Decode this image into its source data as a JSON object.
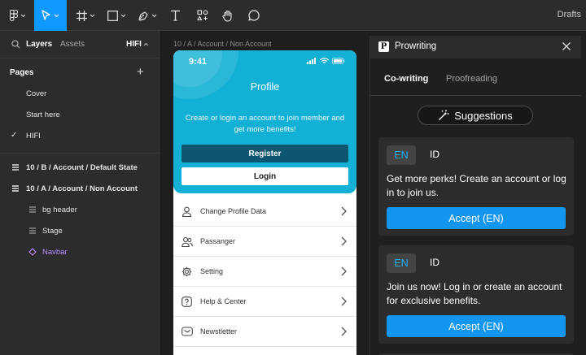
{
  "toolbar": {
    "drafts_label": "Drafts",
    "tools": [
      "figma-menu-icon",
      "move-tool-icon",
      "frame-tool-icon",
      "shape-tool-icon",
      "pen-tool-icon",
      "text-tool-icon",
      "resources-icon",
      "hand-tool-icon",
      "comment-icon"
    ]
  },
  "left_panel": {
    "tabs": {
      "layers": "Layers",
      "assets": "Assets",
      "page_select": "HIFI"
    },
    "pages_title": "Pages",
    "pages": [
      {
        "label": "Cover",
        "selected": false
      },
      {
        "label": "Start here",
        "selected": false
      },
      {
        "label": "HIFI",
        "selected": true
      }
    ],
    "layers": [
      {
        "label": "10 / B / Account / Default State",
        "type": "frame"
      },
      {
        "label": "10 / A / Account / Non Account",
        "type": "frame"
      },
      {
        "label": "bg header",
        "type": "group"
      },
      {
        "label": "Stage",
        "type": "group"
      },
      {
        "label": "Navbar",
        "type": "component"
      }
    ]
  },
  "canvas": {
    "frame_label": "10 / A / Account / Non Account",
    "phone": {
      "time": "9:41",
      "title": "Profile",
      "subtitle": "Create or login an account to join member and get more benefits!",
      "register_label": "Register",
      "login_label": "Login",
      "menu": [
        {
          "label": "Change Profile Data",
          "icon": "user-icon"
        },
        {
          "label": "Passanger",
          "icon": "users-icon"
        },
        {
          "label": "Setting",
          "icon": "gear-icon"
        },
        {
          "label": "Help & Center",
          "icon": "help-icon"
        },
        {
          "label": "Newstletter",
          "icon": "mail-icon"
        }
      ]
    }
  },
  "plugin": {
    "name": "Prowriting",
    "logo_letter": "P",
    "tabs": {
      "active": "Co-writing",
      "inactive": "Proofreading"
    },
    "suggestions_label": "Suggestions",
    "cards": [
      {
        "lang_active": "EN",
        "lang_other": "ID",
        "text": "Get more perks! Create an account or log in to join us.",
        "accept_label": "Accept (EN)"
      },
      {
        "lang_active": "EN",
        "lang_other": "ID",
        "text": "Join us now! Log in or create an account for exclusive benefits.",
        "accept_label": "Accept (EN)"
      }
    ]
  },
  "colors": {
    "accent": "#0d99ff",
    "phone_header": "#12b0d4",
    "register_button": "#0c5670",
    "accept_button": "#1296f0",
    "layer_component": "#b68cff"
  }
}
